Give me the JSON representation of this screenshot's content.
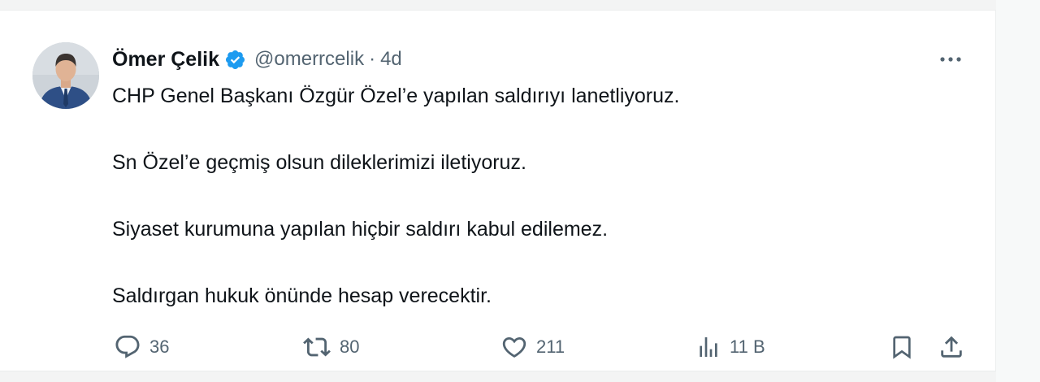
{
  "tweet": {
    "author": {
      "display_name": "Ömer Çelik",
      "handle": "@omerrcelik",
      "verified": true
    },
    "separator": "·",
    "timestamp": "4d",
    "paragraphs": [
      "CHP Genel Başkanı Özgür Özel’e yapılan saldırıyı lanetliyoruz.",
      "Sn Özel’e geçmiş olsun dileklerimizi iletiyoruz.",
      "Siyaset kurumuna yapılan hiçbir saldırı kabul edilemez.",
      "Saldırgan hukuk önünde hesap verecektir."
    ],
    "stats": {
      "replies": "36",
      "retweets": "80",
      "likes": "211",
      "views": "11 B"
    }
  },
  "icons": {
    "verified": "verified-badge-icon",
    "more": "more-dots-icon",
    "reply": "reply-bubble-icon",
    "retweet": "retweet-arrows-icon",
    "like": "heart-icon",
    "views": "bar-chart-icon",
    "bookmark": "bookmark-icon",
    "share": "share-upload-icon"
  },
  "colors": {
    "text_primary": "#0f1419",
    "text_secondary": "#536471",
    "verified_blue": "#1d9bf0"
  }
}
